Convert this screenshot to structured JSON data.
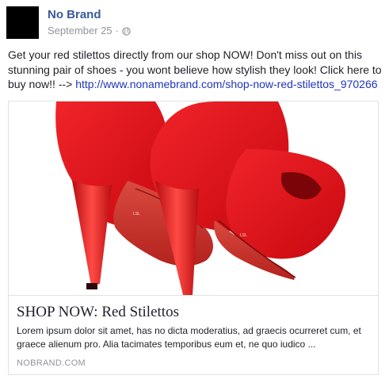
{
  "post": {
    "page_name": "No Brand",
    "date": "September 25",
    "separator": "·",
    "privacy_icon": "globe-icon",
    "text_before_link": "Get your red stilettos directly from our shop NOW! Don't miss out on this stunning pair of shoes - you wont believe how stylish they look! Click here to buy now!! -->",
    "link_text": "http://www.nonamebrand.com/shop-now-red-stilettos_970266"
  },
  "card": {
    "title": "SHOP NOW: Red Stilettos",
    "description": "Lorem ipsum dolor sit amet, has no dicta moderatius, ad graecis ocurreret cum, et graece alienum pro. Alia tacimates temporibus eum et, ne quo iudico ...",
    "domain": "NOBRAND.COM"
  },
  "colors": {
    "link": "#3b5998",
    "url": "#1f35b9",
    "muted": "#90949c",
    "shoe_red": "#e0141a",
    "avatar": "#000000"
  }
}
